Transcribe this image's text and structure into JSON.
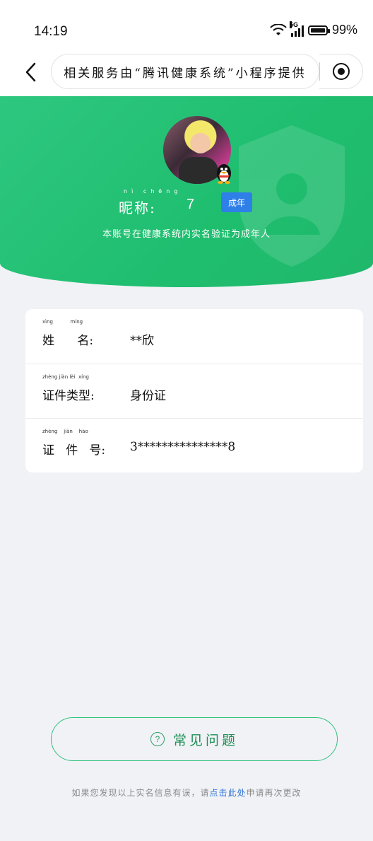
{
  "status_bar": {
    "time": "14:19",
    "network": "5G",
    "battery": "99%"
  },
  "nav": {
    "title": "相关服务由“腾讯健康系统”小程序提供"
  },
  "profile": {
    "nickname_label": "昵称:",
    "nickname_ruby": "nì chēng",
    "nickname_value": "7",
    "adult_badge": "成年",
    "note": "本账号在健康系统内实名验证为成年人"
  },
  "info": {
    "rows": [
      {
        "label": "姓      名:",
        "ruby": "xìng           míng",
        "value": "**欣"
      },
      {
        "label": "证件类型:",
        "ruby": "zhèng jiàn lèi  xíng",
        "value": "身份证"
      },
      {
        "label": "证   件   号:",
        "ruby": "zhèng    jiàn    hào",
        "value": "3***************8"
      }
    ]
  },
  "faq": {
    "label": "常见问题",
    "icon": "?"
  },
  "footer": {
    "text_before": "如果您发现以上实名信息有误，请",
    "link": "点击此处",
    "text_after": "申请再次更改"
  },
  "colors": {
    "green": "#1fbe6f",
    "badge_blue": "#2f7fe8",
    "link_blue": "#2f73d6"
  }
}
